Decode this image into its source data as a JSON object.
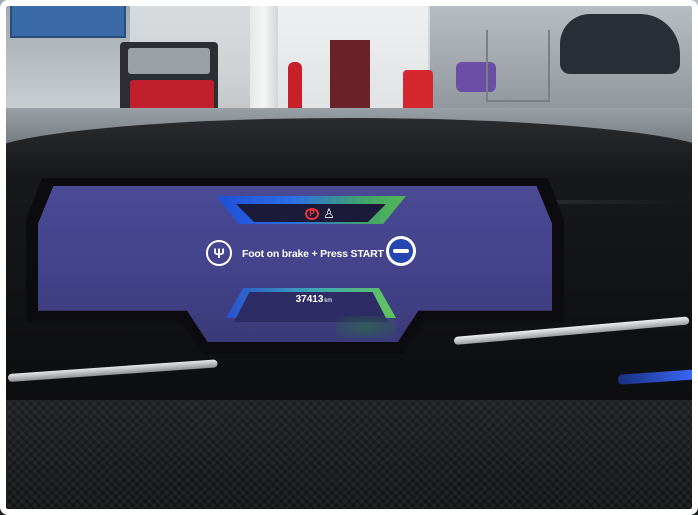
{
  "cluster": {
    "message": "Foot on brake + Press START",
    "odometer_value": "37413",
    "odometer_unit": "km",
    "warning_icons": [
      "parking-brake-warning-icon",
      "seatbelt-warning-icon"
    ],
    "accent_colors": {
      "screen_background": "#4a4a95",
      "gauge_blue": "#2d6ee8",
      "gauge_green": "#52b852",
      "brake_warning": "#e8333a",
      "start_button": "#2546b0"
    }
  }
}
